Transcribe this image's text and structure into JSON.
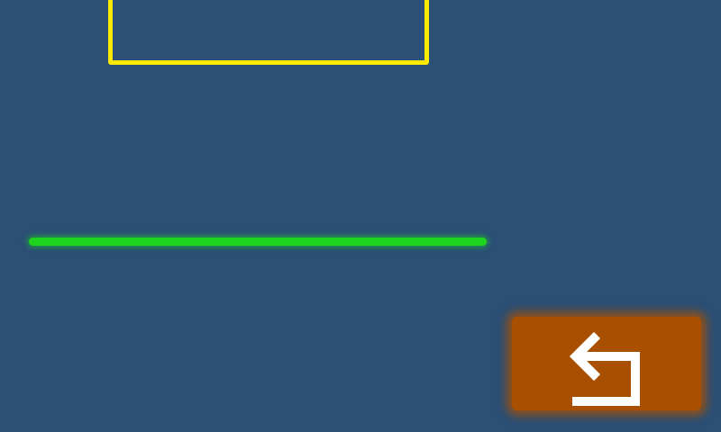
{
  "screen": {
    "background_color": "#2b4f75"
  },
  "frame": {
    "border_color": "#ffea00"
  },
  "status_line": {
    "color": "#1fd41f"
  },
  "back_button": {
    "icon": "return-arrow-icon",
    "background_color": "#a85000",
    "icon_color": "#ffffff"
  }
}
